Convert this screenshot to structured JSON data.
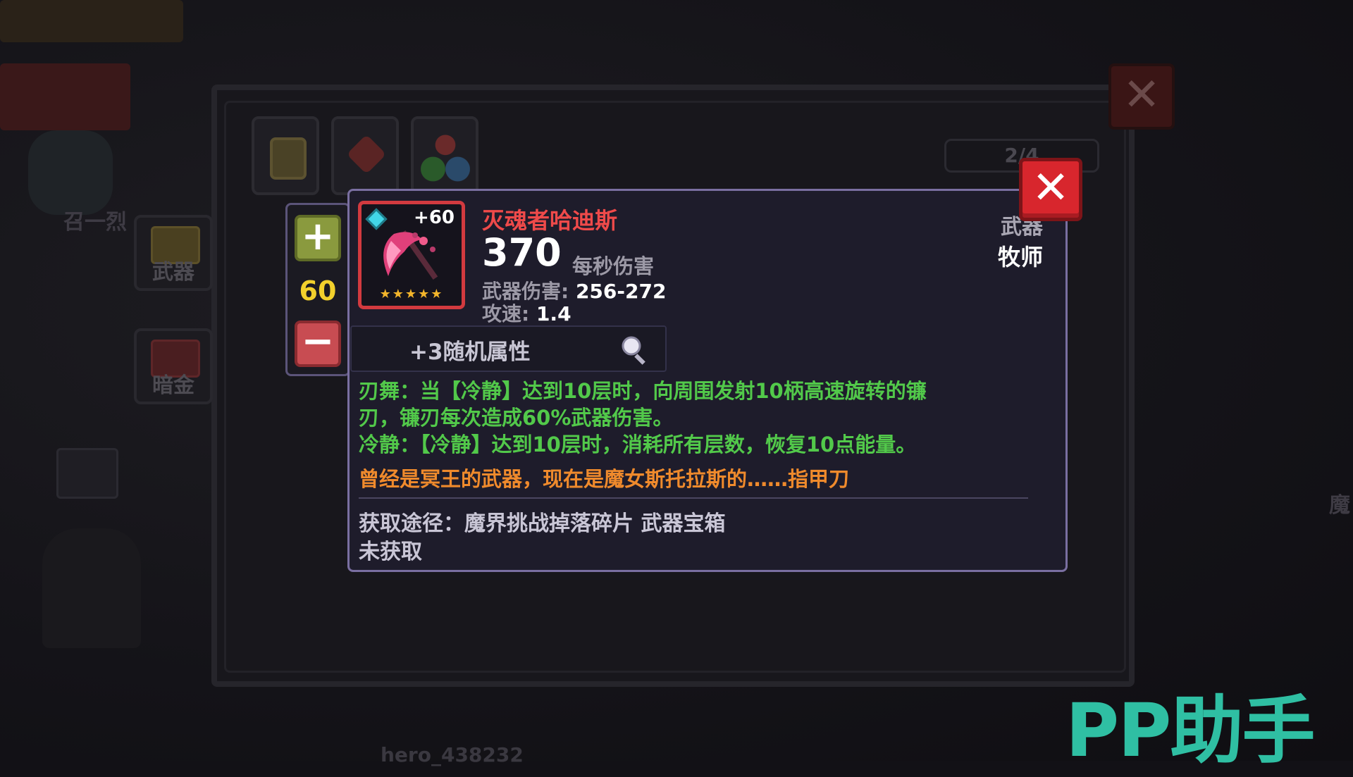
{
  "background": {
    "side_tabs": [
      {
        "label": "武器"
      },
      {
        "label": "暗金"
      }
    ],
    "page_indicator": "2/4",
    "username": "hero_438232",
    "obscured_name": "召一烈",
    "right_edge_text": "魔"
  },
  "stepper": {
    "plus_label": "+",
    "level": "60",
    "minus_label": "−"
  },
  "item": {
    "name": "灭魂者哈迪斯",
    "enhance": "+60",
    "stars": "★★★★★",
    "dps": "370",
    "dps_label": "每秒伤害",
    "damage_label": "武器伤害:",
    "damage_value": "256-272",
    "speed_label": "攻速:",
    "speed_value": "1.4",
    "type": "武器",
    "class": "牧师",
    "random_attr": "+3随机属性",
    "skill_lines": [
      "刃舞：当【冷静】达到10层时，向周围发射10柄高速旋转的镰",
      "刃，镰刃每次造成60%武器伤害。",
      "冷静：【冷静】达到10层时，消耗所有层数，恢复10点能量。"
    ],
    "flavor": "曾经是冥王的武器，现在是魔女斯托拉斯的……指甲刀",
    "obtain": "获取途径：魔界挑战掉落碎片 武器宝箱",
    "status": "未获取"
  },
  "close_label": "✕",
  "watermark": "PP助手",
  "colors": {
    "name_red": "#ef4a4a",
    "skill_green": "#52c94a",
    "flavor_orange": "#ef8a2c",
    "level_yellow": "#f2d02c",
    "card_border": "#7a6fa1",
    "close_red": "#d8262d",
    "watermark_teal": "#2fbfa3"
  }
}
